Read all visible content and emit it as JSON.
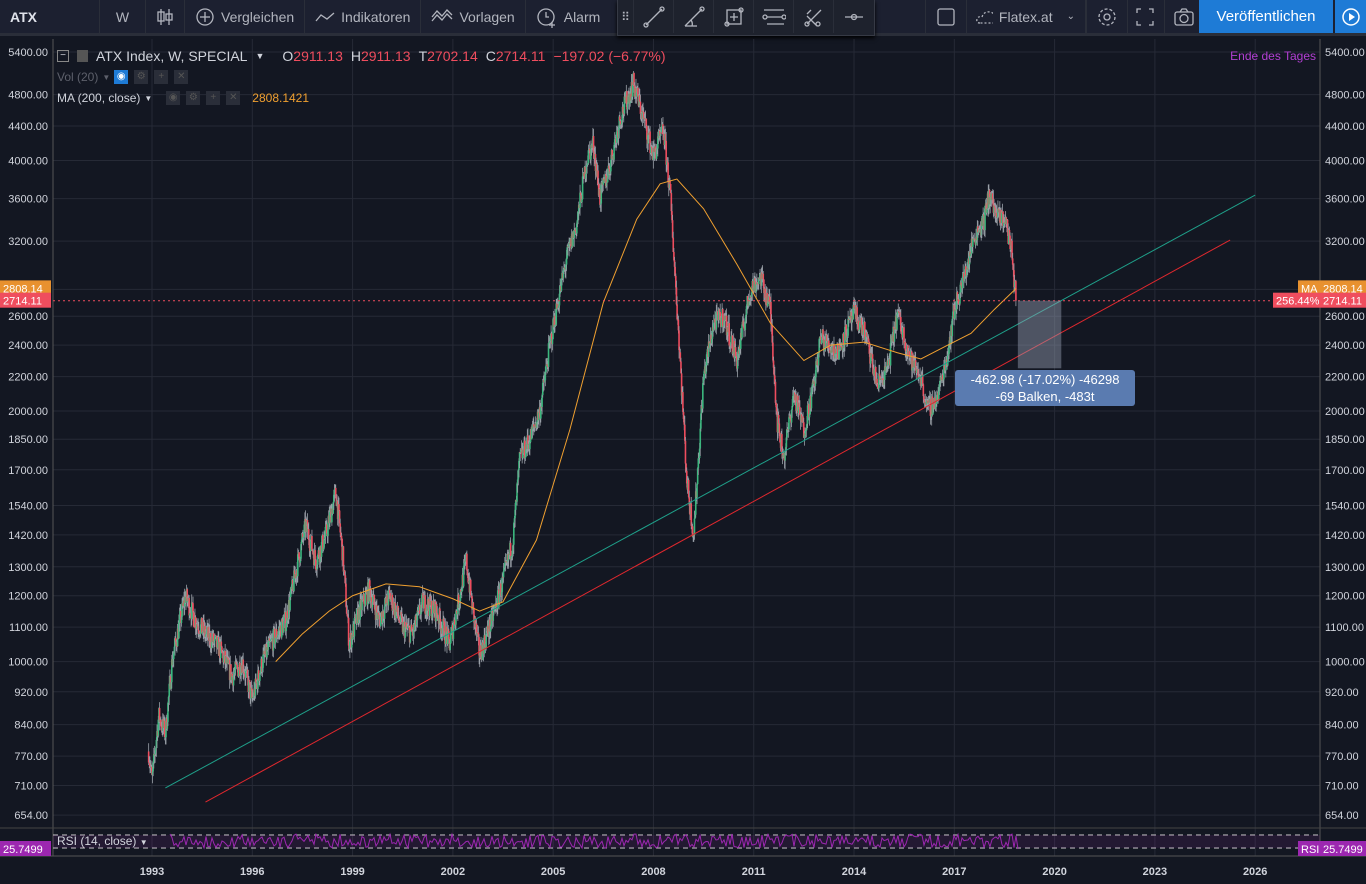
{
  "toolbar": {
    "symbol": "ATX",
    "interval": "W",
    "compare": "Vergleichen",
    "indicators": "Indikatoren",
    "templates": "Vorlagen",
    "alert": "Alarm",
    "broker": "Flatex.at",
    "publish": "Veröffentlichen"
  },
  "drawing_tools": [
    "trend-line-icon",
    "fib-icon",
    "rectangle-icon",
    "horizontal-lines-icon",
    "pitchfork-icon",
    "horizontal-ray-icon"
  ],
  "legend": {
    "title": "ATX Index, W, SPECIAL",
    "o_label": "O",
    "o": "2911.13",
    "h_label": "H",
    "h": "2911.13",
    "t_label": "T",
    "t": "2702.14",
    "c_label": "C",
    "c": "2714.11",
    "change": "−197.02 (−6.77%)",
    "vol": "Vol (20)",
    "ma": "MA (200, close)",
    "ma_value": "2808.1421",
    "session": "Ende des Tages"
  },
  "rsi": {
    "label": "RSI (14, close)",
    "value": "25.7499",
    "badge": "RSI"
  },
  "price_badges": {
    "ma": "2808.14",
    "ma_tag": "MA",
    "last": "2714.11",
    "pct": "256.44%"
  },
  "measure": {
    "line1": "-462.98 (-17.02%) -46298",
    "line2": "-69 Balken, -483t"
  },
  "colors": {
    "bg": "#131722",
    "up": "#3bb77e",
    "down": "#ef4d5e",
    "ma": "#f0a030",
    "trend1": "#1fa08a",
    "trend2": "#e0282e",
    "rsi": "#9c27b0",
    "accent": "#1e7bd6"
  },
  "chart_data": {
    "type": "candlestick",
    "scale": "log",
    "interval": "weekly",
    "y_ticks": [
      5400,
      4800,
      4400,
      4000,
      3600,
      3200,
      2800,
      2600,
      2400,
      2200,
      2000,
      1850,
      1700,
      1540,
      1420,
      1300,
      1200,
      1100,
      1000,
      920,
      840,
      770,
      710,
      654
    ],
    "x_ticks": [
      "1993",
      "1996",
      "1999",
      "2002",
      "2005",
      "2008",
      "2011",
      "2014",
      "2017",
      "2020",
      "2023",
      "2026"
    ],
    "price_path": [
      [
        1992.9,
        780
      ],
      [
        1993.0,
        720
      ],
      [
        1993.2,
        860
      ],
      [
        1993.4,
        820
      ],
      [
        1993.6,
        1000
      ],
      [
        1993.8,
        1100
      ],
      [
        1994.0,
        1200
      ],
      [
        1994.3,
        1120
      ],
      [
        1994.6,
        1080
      ],
      [
        1995.0,
        1040
      ],
      [
        1995.4,
        960
      ],
      [
        1995.7,
        1000
      ],
      [
        1996.0,
        900
      ],
      [
        1996.3,
        1000
      ],
      [
        1996.6,
        1060
      ],
      [
        1997.0,
        1120
      ],
      [
        1997.3,
        1280
      ],
      [
        1997.6,
        1460
      ],
      [
        1997.9,
        1320
      ],
      [
        1998.2,
        1420
      ],
      [
        1998.5,
        1600
      ],
      [
        1998.7,
        1350
      ],
      [
        1998.9,
        1050
      ],
      [
        1999.2,
        1150
      ],
      [
        1999.5,
        1220
      ],
      [
        1999.8,
        1120
      ],
      [
        2000.1,
        1200
      ],
      [
        2000.5,
        1100
      ],
      [
        2000.8,
        1080
      ],
      [
        2001.1,
        1180
      ],
      [
        2001.5,
        1150
      ],
      [
        2001.9,
        1050
      ],
      [
        2002.2,
        1200
      ],
      [
        2002.4,
        1320
      ],
      [
        2002.6,
        1150
      ],
      [
        2002.8,
        1020
      ],
      [
        2003.1,
        1100
      ],
      [
        2003.5,
        1250
      ],
      [
        2003.8,
        1400
      ],
      [
        2004.0,
        1750
      ],
      [
        2004.3,
        1850
      ],
      [
        2004.6,
        2000
      ],
      [
        2004.9,
        2400
      ],
      [
        2005.1,
        2650
      ],
      [
        2005.4,
        3050
      ],
      [
        2005.7,
        3350
      ],
      [
        2006.0,
        4000
      ],
      [
        2006.2,
        4200
      ],
      [
        2006.4,
        3600
      ],
      [
        2006.7,
        3950
      ],
      [
        2007.0,
        4500
      ],
      [
        2007.4,
        4950
      ],
      [
        2007.7,
        4500
      ],
      [
        2008.0,
        4050
      ],
      [
        2008.3,
        4350
      ],
      [
        2008.5,
        3650
      ],
      [
        2008.8,
        2300
      ],
      [
        2009.0,
        1650
      ],
      [
        2009.2,
        1420
      ],
      [
        2009.5,
        2200
      ],
      [
        2009.8,
        2550
      ],
      [
        2010.1,
        2600
      ],
      [
        2010.5,
        2300
      ],
      [
        2010.9,
        2800
      ],
      [
        2011.2,
        2900
      ],
      [
        2011.5,
        2650
      ],
      [
        2011.7,
        1950
      ],
      [
        2011.9,
        1760
      ],
      [
        2012.2,
        2100
      ],
      [
        2012.5,
        1900
      ],
      [
        2012.8,
        2150
      ],
      [
        2013.0,
        2450
      ],
      [
        2013.5,
        2350
      ],
      [
        2014.0,
        2620
      ],
      [
        2014.3,
        2500
      ],
      [
        2014.7,
        2150
      ],
      [
        2015.0,
        2250
      ],
      [
        2015.3,
        2620
      ],
      [
        2015.7,
        2300
      ],
      [
        2016.0,
        2200
      ],
      [
        2016.2,
        2000
      ],
      [
        2016.5,
        2080
      ],
      [
        2016.8,
        2350
      ],
      [
        2017.0,
        2650
      ],
      [
        2017.3,
        2900
      ],
      [
        2017.6,
        3250
      ],
      [
        2017.9,
        3400
      ],
      [
        2018.05,
        3650
      ],
      [
        2018.3,
        3400
      ],
      [
        2018.5,
        3420
      ],
      [
        2018.7,
        3150
      ],
      [
        2018.85,
        2714.11
      ]
    ],
    "ma200_path": [
      [
        1996.7,
        1000
      ],
      [
        1997.5,
        1080
      ],
      [
        1998.3,
        1150
      ],
      [
        1999.0,
        1200
      ],
      [
        2000.0,
        1240
      ],
      [
        2001.0,
        1230
      ],
      [
        2002.0,
        1190
      ],
      [
        2002.8,
        1150
      ],
      [
        2003.5,
        1180
      ],
      [
        2004.5,
        1400
      ],
      [
        2005.5,
        1900
      ],
      [
        2006.5,
        2700
      ],
      [
        2007.5,
        3400
      ],
      [
        2008.2,
        3750
      ],
      [
        2008.7,
        3800
      ],
      [
        2009.5,
        3500
      ],
      [
        2010.5,
        3000
      ],
      [
        2011.5,
        2550
      ],
      [
        2012.5,
        2300
      ],
      [
        2013.3,
        2400
      ],
      [
        2014.3,
        2420
      ],
      [
        2015.3,
        2350
      ],
      [
        2016.0,
        2310
      ],
      [
        2016.8,
        2400
      ],
      [
        2017.5,
        2480
      ],
      [
        2018.2,
        2650
      ],
      [
        2018.85,
        2808.14
      ]
    ],
    "trend_lines": [
      {
        "color": "#1fa08a",
        "from": [
          1993.4,
          705
        ],
        "to": [
          2026.0,
          3635
        ]
      },
      {
        "color": "#e0282e",
        "from": [
          1994.6,
          678
        ],
        "to": [
          2025.25,
          3210
        ]
      }
    ],
    "measure_range": {
      "from": [
        2018.9,
        2714.11
      ],
      "to": [
        2020.2,
        2251.13
      ]
    },
    "last_price": 2714.11,
    "rsi_last": 25.7499
  }
}
